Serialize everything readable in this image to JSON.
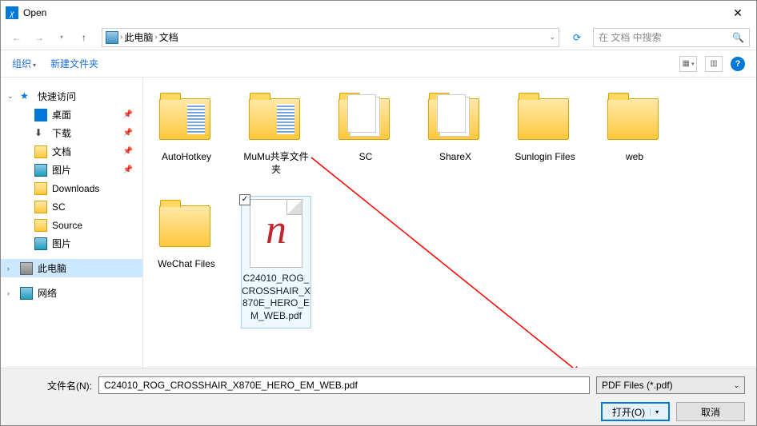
{
  "title": "Open",
  "breadcrumb": {
    "pc": "此电脑",
    "loc": "文档"
  },
  "search": {
    "placeholder": "在 文档 中搜索"
  },
  "toolbar": {
    "organize": "组织",
    "newfolder": "新建文件夹"
  },
  "sidebar": {
    "quick": "快速访问",
    "desktop": "桌面",
    "downloads_cn": "下载",
    "docs": "文档",
    "pics": "图片",
    "downloads_en": "Downloads",
    "sc": "SC",
    "source": "Source",
    "pics2": "图片",
    "thispc": "此电脑",
    "network": "网络"
  },
  "files": [
    {
      "name": "AutoHotkey",
      "type": "folder-stripes"
    },
    {
      "name": "MuMu共享文件夹",
      "type": "folder-stripes"
    },
    {
      "name": "SC",
      "type": "folder-docs"
    },
    {
      "name": "ShareX",
      "type": "folder-docs"
    },
    {
      "name": "Sunlogin Files",
      "type": "folder"
    },
    {
      "name": "web",
      "type": "folder"
    },
    {
      "name": "WeChat Files",
      "type": "folder"
    },
    {
      "name": "C24010_ROG_CROSSHAIR_X870E_HERO_EM_WEB.pdf",
      "type": "pdf",
      "selected": true
    }
  ],
  "footer": {
    "filename_label": "文件名(N):",
    "filename_value": "C24010_ROG_CROSSHAIR_X870E_HERO_EM_WEB.pdf",
    "filetype": "PDF Files (*.pdf)",
    "open": "打开(O)",
    "cancel": "取消"
  }
}
